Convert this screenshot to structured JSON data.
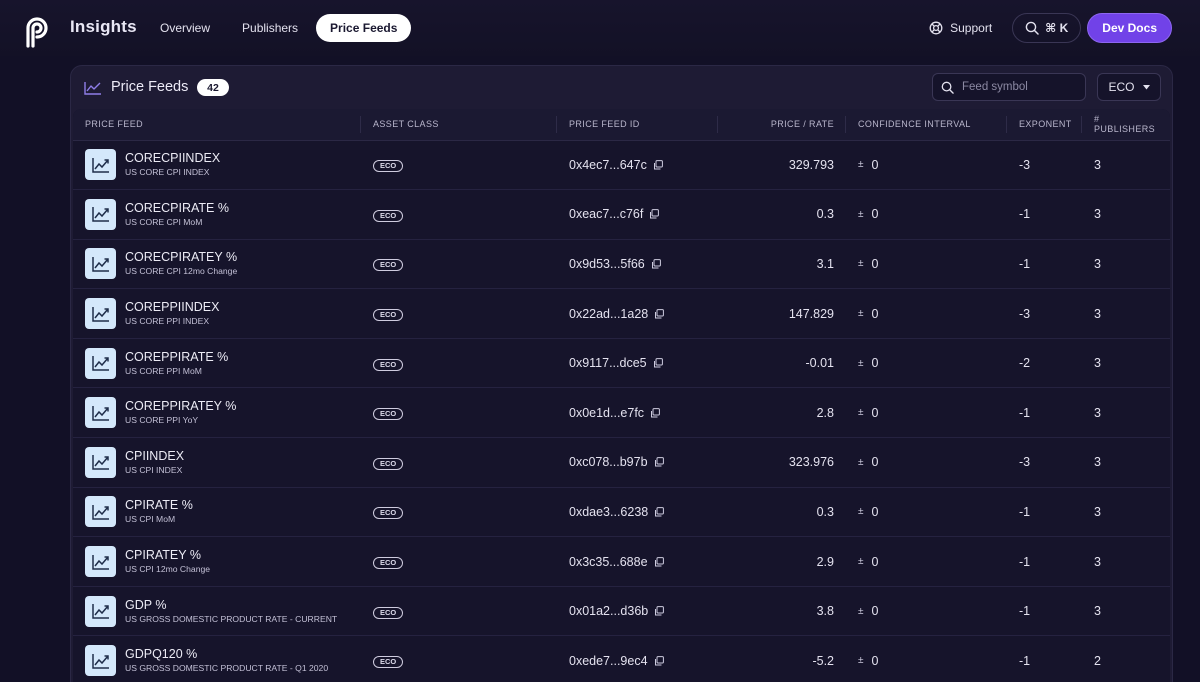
{
  "header": {
    "app_title": "Insights",
    "nav": [
      {
        "label": "Overview",
        "active": false
      },
      {
        "label": "Publishers",
        "active": false
      },
      {
        "label": "Price Feeds",
        "active": true
      }
    ],
    "support_label": "Support",
    "shortcut_label": "⌘ K",
    "dev_docs_label": "Dev Docs"
  },
  "panel": {
    "title": "Price Feeds",
    "count": "42",
    "search_placeholder": "Feed symbol",
    "filter_value": "ECO"
  },
  "table": {
    "columns": [
      "PRICE FEED",
      "ASSET CLASS",
      "PRICE FEED ID",
      "PRICE / RATE",
      "CONFIDENCE INTERVAL",
      "EXPONENT",
      "# PUBLISHERS"
    ],
    "rows": [
      {
        "name": "CORECPIINDEX",
        "desc": "US CORE CPI INDEX",
        "asset": "ECO",
        "id": "0x4ec7...647c",
        "price": "329.793",
        "conf": "0",
        "exponent": "-3",
        "publishers": "3"
      },
      {
        "name": "CORECPIRATE %",
        "desc": "US CORE CPI MoM",
        "asset": "ECO",
        "id": "0xeac7...c76f",
        "price": "0.3",
        "conf": "0",
        "exponent": "-1",
        "publishers": "3"
      },
      {
        "name": "CORECPIRATEY %",
        "desc": "US CORE CPI 12mo Change",
        "asset": "ECO",
        "id": "0x9d53...5f66",
        "price": "3.1",
        "conf": "0",
        "exponent": "-1",
        "publishers": "3"
      },
      {
        "name": "COREPPIINDEX",
        "desc": "US CORE PPI INDEX",
        "asset": "ECO",
        "id": "0x22ad...1a28",
        "price": "147.829",
        "conf": "0",
        "exponent": "-3",
        "publishers": "3"
      },
      {
        "name": "COREPPIRATE %",
        "desc": "US CORE PPI MoM",
        "asset": "ECO",
        "id": "0x9117...dce5",
        "price": "-0.01",
        "conf": "0",
        "exponent": "-2",
        "publishers": "3"
      },
      {
        "name": "COREPPIRATEY %",
        "desc": "US CORE PPI YoY",
        "asset": "ECO",
        "id": "0x0e1d...e7fc",
        "price": "2.8",
        "conf": "0",
        "exponent": "-1",
        "publishers": "3"
      },
      {
        "name": "CPIINDEX",
        "desc": "US CPI INDEX",
        "asset": "ECO",
        "id": "0xc078...b97b",
        "price": "323.976",
        "conf": "0",
        "exponent": "-3",
        "publishers": "3"
      },
      {
        "name": "CPIRATE %",
        "desc": "US CPI MoM",
        "asset": "ECO",
        "id": "0xdae3...6238",
        "price": "0.3",
        "conf": "0",
        "exponent": "-1",
        "publishers": "3"
      },
      {
        "name": "CPIRATEY %",
        "desc": "US CPI 12mo Change",
        "asset": "ECO",
        "id": "0x3c35...688e",
        "price": "2.9",
        "conf": "0",
        "exponent": "-1",
        "publishers": "3"
      },
      {
        "name": "GDP %",
        "desc": "US GROSS DOMESTIC PRODUCT RATE - CURRENT",
        "asset": "ECO",
        "id": "0x01a2...d36b",
        "price": "3.8",
        "conf": "0",
        "exponent": "-1",
        "publishers": "3"
      },
      {
        "name": "GDPQ120 %",
        "desc": "US GROSS DOMESTIC PRODUCT RATE - Q1 2020",
        "asset": "ECO",
        "id": "0xede7...9ec4",
        "price": "-5.2",
        "conf": "0",
        "exponent": "-1",
        "publishers": "2"
      }
    ]
  },
  "colors": {
    "background": "#121026",
    "card": "#1e1b34",
    "accent": "#7142e8",
    "feed_icon_bg": "#d4e8fb"
  },
  "icons": {
    "logo": "pyth-logo",
    "support": "lifebuoy-icon",
    "search": "search-icon",
    "panel": "line-chart-icon",
    "feed": "chart-trend-icon",
    "copy": "copy-icon",
    "confidence": "plus-minus-icon",
    "dropdown": "caret-down-icon"
  }
}
